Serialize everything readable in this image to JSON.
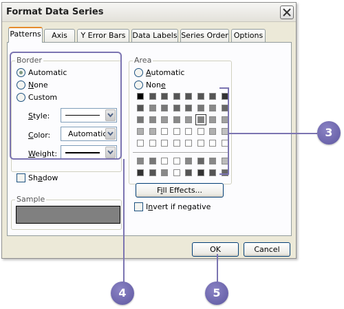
{
  "dialog": {
    "title": "Format Data Series",
    "close_icon": "close-icon"
  },
  "tabs": [
    {
      "label": "Patterns",
      "active": true
    },
    {
      "label": "Axis"
    },
    {
      "label": "Y Error Bars"
    },
    {
      "label": "Data Labels"
    },
    {
      "label": "Series Order"
    },
    {
      "label": "Options"
    }
  ],
  "border": {
    "group_label": "Border",
    "automatic": {
      "pre": "",
      "key": "",
      "post": "Automatic",
      "selected": true
    },
    "none": {
      "pre": "",
      "key": "N",
      "post": "one",
      "selected": false
    },
    "custom": {
      "pre": "",
      "key": "",
      "post": "Custom",
      "selected": false
    },
    "style": {
      "key": "S",
      "post": "tyle:",
      "value": "solid line"
    },
    "color": {
      "key": "C",
      "post": "olor:",
      "value": "Automatic"
    },
    "weight": {
      "key": "W",
      "post": "eight:",
      "value": "thin line"
    }
  },
  "shadow": {
    "pre": "Sh",
    "key": "a",
    "post": "dow",
    "checked": false
  },
  "sample": {
    "group_label": "Sample",
    "fill_color": "#808080"
  },
  "area": {
    "group_label": "Area",
    "automatic": {
      "pre": "",
      "key": "A",
      "post": "utomatic",
      "selected": false
    },
    "none": {
      "pre": "Non",
      "key": "e",
      "post": "",
      "selected": false
    },
    "palette_rows": [
      [
        "#000000",
        "#555555",
        "#555555",
        "#555555",
        "#555555",
        "#555555",
        "#555555",
        "#333333"
      ],
      [
        "#555555",
        "#888888",
        "#777777",
        "#666666",
        "#666666",
        "#777777",
        "#888888",
        "#666666"
      ],
      [
        "#777777",
        "#888888",
        "#999999",
        "#888888",
        "#999999",
        "#808080",
        "#999999",
        "#a0a0a0"
      ],
      [
        "#b0b0b0",
        "#b0b0b0",
        "#ffffff",
        "#ffffff",
        "#ffffff",
        "#ffffff",
        "#b0b0b0",
        "#c0c0c0"
      ],
      [
        "#ffffff",
        "#ffffff",
        "#ffffff",
        "#ffffff",
        "#ffffff",
        "#ffffff",
        "#ffffff",
        "#ffffff"
      ]
    ],
    "palette_rows_2": [
      [
        "#888888",
        "#777777",
        "#ffffff",
        "#ffffff",
        "#888888",
        "#666666",
        "#888888",
        "#bbbbbb"
      ],
      [
        "#333333",
        "#555555",
        "#888888",
        "#ffffff",
        "#555555",
        "#333333",
        "#555555",
        "#666666"
      ]
    ],
    "fill_effects": {
      "pre": "F",
      "key": "i",
      "post": "ll Effects..."
    },
    "invert": {
      "pre": "I",
      "key": "n",
      "post": "vert if negative",
      "checked": false
    }
  },
  "buttons": {
    "ok": "OK",
    "cancel": "Cancel"
  },
  "callouts": {
    "three": "3",
    "four": "4",
    "five": "5",
    "accent": "#6d65ab"
  }
}
